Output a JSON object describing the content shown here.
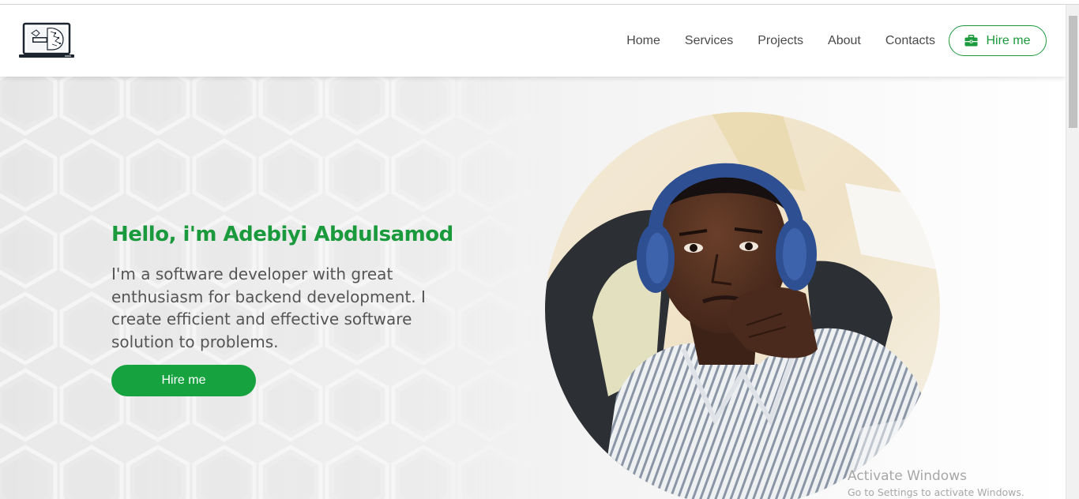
{
  "nav": {
    "items": [
      {
        "label": "Home"
      },
      {
        "label": "Services"
      },
      {
        "label": "Projects"
      },
      {
        "label": "About"
      },
      {
        "label": "Contacts"
      }
    ],
    "hire_label": "Hire me",
    "hire_icon": "briefcase-icon"
  },
  "hero": {
    "title": "Hello, i'm Adebiyi Abdulsamod",
    "description": "I'm a software developer with great enthusiasm for backend development. I create efficient and effective software solution to problems.",
    "button_label": "Hire me"
  },
  "watermark": {
    "title": "Activate Windows",
    "subtitle": "Go to Settings to activate Windows."
  },
  "colors": {
    "accent": "#1a9a3c",
    "button": "#16a23f",
    "text": "#555555"
  }
}
